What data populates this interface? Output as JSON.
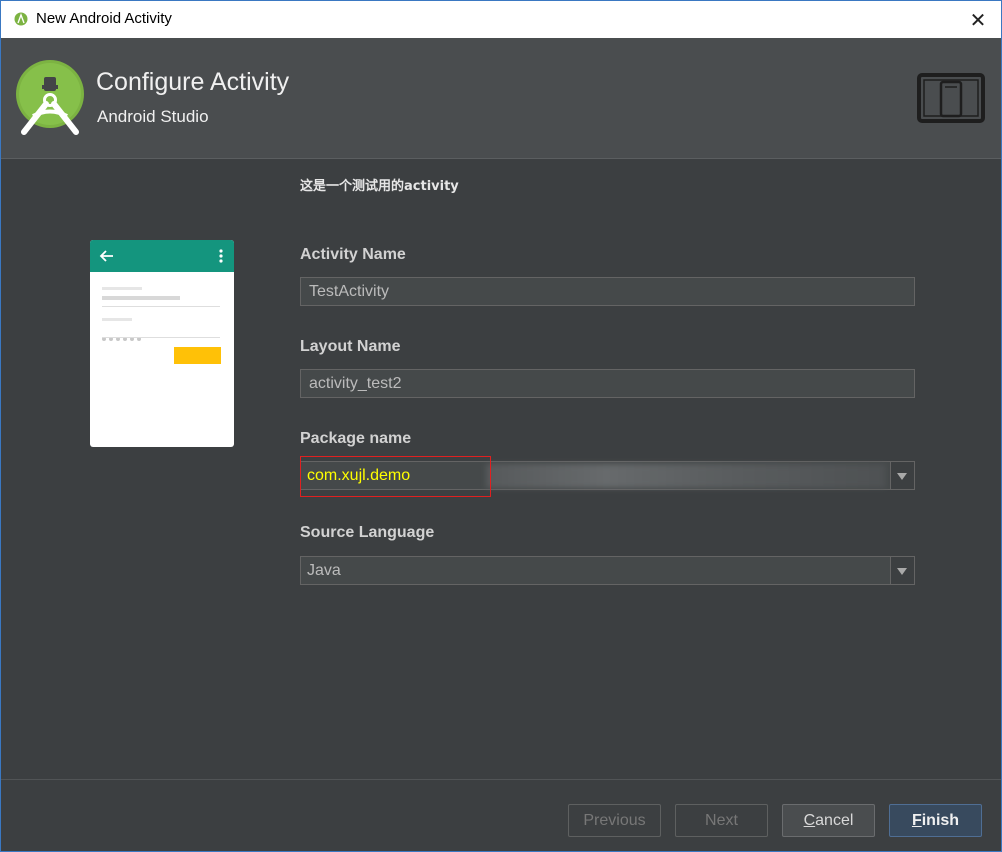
{
  "window": {
    "title": "New Android Activity",
    "close_glyph": "✕"
  },
  "header": {
    "title": "Configure Activity",
    "subtitle": "Android Studio",
    "logo_icon": "android-studio-logo-icon",
    "device_icon": "tablet-phone-icon"
  },
  "description": "这是一个测试用的activity",
  "form": {
    "activity_name": {
      "label": "Activity Name",
      "value": "TestActivity"
    },
    "layout_name": {
      "label": "Layout Name",
      "value": "activity_test2"
    },
    "package_name": {
      "label": "Package name",
      "value": "com.xujl.demo"
    },
    "source_language": {
      "label": "Source Language",
      "value": "Java"
    }
  },
  "buttons": {
    "previous": "Previous",
    "next": "Next",
    "cancel_mnemonic": "C",
    "cancel_rest": "ancel",
    "finish_mnemonic": "F",
    "finish_rest": "inish"
  },
  "colors": {
    "background": "#3c3f41",
    "header_bg": "#4a4d4f",
    "phone_toolbar": "#14957e",
    "phone_button": "#ffc107",
    "highlight_border": "#e02020",
    "package_text": "#ffff00",
    "finish_bg": "#384a5e"
  }
}
